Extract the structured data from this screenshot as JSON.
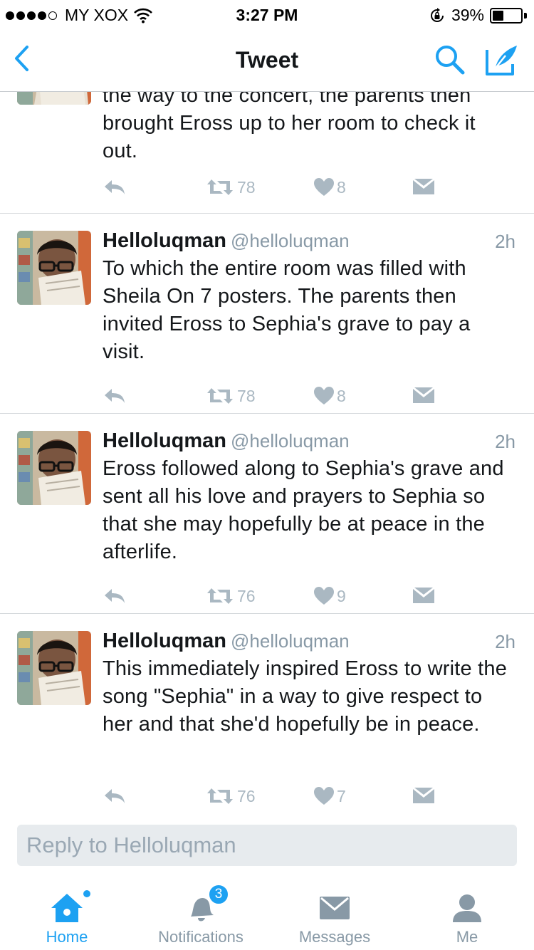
{
  "status_bar": {
    "carrier": "MY XOX",
    "time": "3:27 PM",
    "battery": "39%",
    "battery_level": 0.39
  },
  "nav": {
    "title": "Tweet"
  },
  "colors": {
    "accent": "#1da1f2",
    "muted": "#8899a6",
    "icon_gray": "#aab8c2"
  },
  "tweets": [
    {
      "text": "the way to the concert, the parents then brought Eross up to her room to check it out.",
      "retweets": "78",
      "likes": "8"
    },
    {
      "name": "Helloluqman",
      "handle": "@helloluqman",
      "time": "2h",
      "text": "To which the entire room was filled with Sheila On 7 posters. The parents then invited Eross to Sephia's grave to pay a visit.",
      "retweets": "78",
      "likes": "8"
    },
    {
      "name": "Helloluqman",
      "handle": "@helloluqman",
      "time": "2h",
      "text": "Eross followed along to Sephia's grave and sent all his love and prayers to Sephia so that she may hopefully be at peace in the afterlife.",
      "retweets": "76",
      "likes": "9"
    },
    {
      "name": "Helloluqman",
      "handle": "@helloluqman",
      "time": "2h",
      "text": "This immediately inspired Eross to write the song \"Sephia\" in a way to give respect to her and that she'd hopefully be in peace.",
      "retweets": "76",
      "likes": "7"
    }
  ],
  "reply": {
    "placeholder": "Reply to Helloluqman"
  },
  "tabs": {
    "home": "Home",
    "notifications": "Notifications",
    "notifications_badge": "3",
    "messages": "Messages",
    "me": "Me"
  }
}
